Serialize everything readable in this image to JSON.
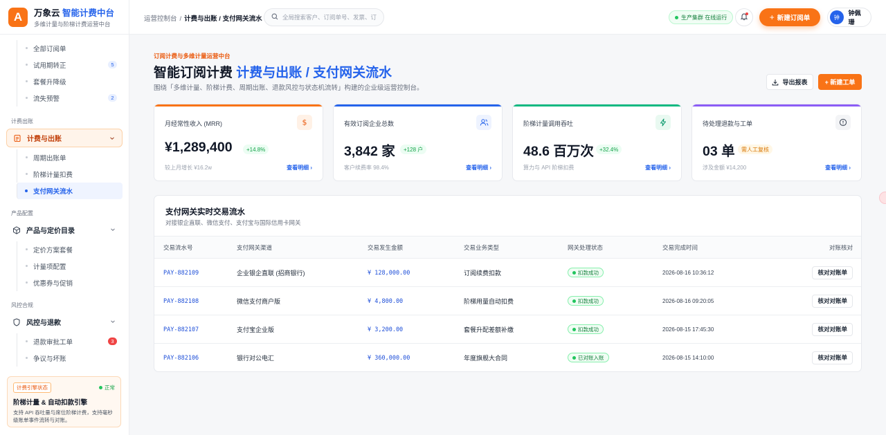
{
  "brand": {
    "logo": "A",
    "name": "万象云",
    "name_accent": "智能计费中台",
    "tagline": "多维计量与阶梯计费运营中台"
  },
  "sidebar": {
    "subscription_items": [
      {
        "label": "全部订阅单",
        "badge": ""
      },
      {
        "label": "试用期转正",
        "badge": "5"
      },
      {
        "label": "套餐升降级",
        "badge": ""
      },
      {
        "label": "流失预警",
        "badge": "2"
      }
    ],
    "billing": {
      "section": "计费出账",
      "group": "计费与出账",
      "items": [
        "周期出账单",
        "阶梯计量扣费",
        "支付网关流水"
      ],
      "active": "支付网关流水"
    },
    "product": {
      "section": "产品配置",
      "group": "产品与定价目录",
      "items": [
        "定价方案套餐",
        "计量项配置",
        "优惠券与促销"
      ]
    },
    "risk": {
      "section": "风控合规",
      "group": "风控与退款",
      "items": [
        {
          "label": "退款审批工单",
          "badge": "3"
        },
        {
          "label": "争议与坏账",
          "badge": ""
        }
      ]
    },
    "engine_card": {
      "tag": "计费引擎状态",
      "status": "正常",
      "title": "阶梯计量 & 自动扣款引擎",
      "desc": "支持 API 吞吐量与席位阶梯计费，支持毫秒级账单事件流转与对账。"
    }
  },
  "topbar": {
    "breadcrumb_root": "运营控制台",
    "breadcrumb_sep": "/",
    "breadcrumb_current": "计费与出账 / 支付网关流水",
    "search_placeholder": "全局搜索客户、订阅单号、发票、订",
    "cluster_status": "生产集群 在线运行",
    "new_subscription": "新建订阅单",
    "user_initial": "钟",
    "user_name": "钟佩珊"
  },
  "page": {
    "eyebrow": "订阅计费与多维计量运营中台",
    "title_prefix": "智能订阅计费",
    "title_accent": "计费与出账 / 支付网关流水",
    "subtitle": "围绕「多维计量、阶梯计费、周期出账、退款风控与状态机流转」构建的企业级运营控制台。",
    "export_label": "导出报表",
    "new_ticket_label": "+ 新建工单"
  },
  "kpis": [
    {
      "label": "月经常性收入 (MRR)",
      "value": "¥1,289,400",
      "chip": "+14.8%",
      "foot": "较上月增长 ¥16.2w",
      "link": "查看明细 ›",
      "color": "#f97316",
      "icon": "dollar-icon"
    },
    {
      "label": "有效订阅企业总数",
      "value": "3,842 家",
      "chip": "+128 户",
      "foot": "客户续费率 98.4%",
      "link": "查看明细 ›",
      "color": "#2563eb",
      "icon": "users-icon"
    },
    {
      "label": "阶梯计量调用吞吐",
      "value": "48.6 百万次",
      "chip": "+32.4%",
      "foot": "算力与 API 阶梯扣费",
      "link": "查看明细 ›",
      "color": "#10b981",
      "icon": "lightning-icon"
    },
    {
      "label": "待处理退款与工单",
      "value": "03 单",
      "chip": "需人工复核",
      "foot": "涉及金额 ¥14,200",
      "link": "查看明细 ›",
      "color": "#8b5cf6",
      "icon": "alert-circle-icon"
    }
  ],
  "transactions": {
    "title": "支付网关实时交易流水",
    "subtitle": "对接银企直联、微信支付、支付宝与国际信用卡网关",
    "columns": [
      "交易流水号",
      "支付网关渠道",
      "交易发生金额",
      "交易业务类型",
      "网关处理状态",
      "交易完成时间",
      "对账核对"
    ],
    "rows": [
      {
        "id": "PAY-882109",
        "channel": "企业银企直联 (招商银行)",
        "amount": "¥ 128,000.00",
        "type": "订阅续费扣款",
        "status": "扣款成功",
        "time": "2026-08-16 10:36:12",
        "action": "核对对账单"
      },
      {
        "id": "PAY-882108",
        "channel": "微信支付商户版",
        "amount": "¥ 4,800.00",
        "type": "阶梯用量自动扣费",
        "status": "扣款成功",
        "time": "2026-08-16 09:20:05",
        "action": "核对对账单"
      },
      {
        "id": "PAY-882107",
        "channel": "支付宝企业版",
        "amount": "¥ 3,200.00",
        "type": "套餐升配差额补缴",
        "status": "扣款成功",
        "time": "2026-08-15 17:45:30",
        "action": "核对对账单"
      },
      {
        "id": "PAY-882106",
        "channel": "银行对公电汇",
        "amount": "¥ 360,000.00",
        "type": "年度旗舰大合同",
        "status": "已对账入账",
        "time": "2026-08-15 14:10:00",
        "action": "核对对账单"
      }
    ]
  },
  "colors": {
    "brand": "#f97316",
    "accent": "#2563eb",
    "success": "#16a34a"
  }
}
